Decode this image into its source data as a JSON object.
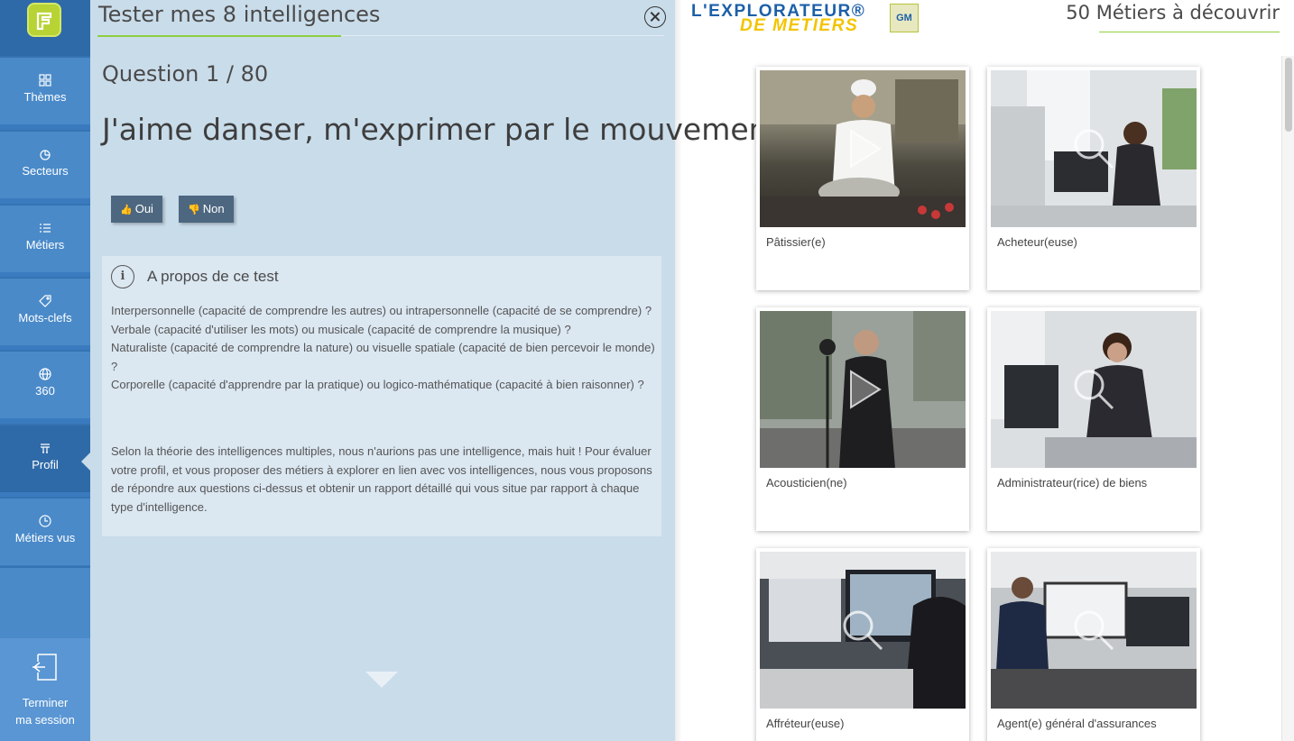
{
  "sidebar": {
    "items": [
      {
        "label": "Thèmes",
        "icon": "grid-icon"
      },
      {
        "label": "Secteurs",
        "icon": "pie-icon"
      },
      {
        "label": "Métiers",
        "icon": "list-icon"
      },
      {
        "label": "Mots-clefs",
        "icon": "tag-icon"
      },
      {
        "label": "360",
        "icon": "globe-icon"
      },
      {
        "label": "Profil",
        "icon": "profile-icon",
        "active": true
      },
      {
        "label": "Métiers vus",
        "icon": "clock-icon"
      }
    ],
    "logout_line1": "Terminer",
    "logout_line2": "ma session"
  },
  "test": {
    "title": "Tester mes 8 intelligences",
    "question_count": "Question 1 / 80",
    "question": "J'aime danser, m'exprimer par le mouvement.",
    "yes_label": "Oui",
    "no_label": "Non",
    "about_title": "A propos de ce test",
    "about_p1": "Interpersonnelle (capacité de comprendre les autres) ou intrapersonnelle (capacité de se comprendre) ?\nVerbale (capacité d'utiliser les mots) ou musicale (capacité de comprendre la musique) ?\nNaturaliste (capacité de comprendre la nature) ou visuelle spatiale (capacité de bien percevoir le monde) ?\nCorporelle (capacité d'apprendre par la pratique) ou logico-mathématique (capacité à bien raisonner) ?",
    "about_p2": "Selon la théorie des intelligences multiples, nous n'aurions pas une intelligence, mais huit ! Pour évaluer votre profil, et vous proposer des métiers à explorer en lien avec vos intelligences, nous vous proposons de répondre aux questions ci-dessus et obtenir un rapport détaillé qui vous situe par rapport à chaque type d'intelligence."
  },
  "brand": {
    "line1": "L'EXPLORATEUR®",
    "line2": "DE METIERS",
    "badge": "GM"
  },
  "jobs": {
    "count_title": "50 Métiers à découvrir",
    "cards": [
      {
        "label": "Pâtissier(e)",
        "overlay": "play-icon",
        "scene": "kitchen"
      },
      {
        "label": "Acheteur(euse)",
        "overlay": "magnifier-icon",
        "scene": "office"
      },
      {
        "label": "Acousticien(ne)",
        "overlay": "play-icon",
        "scene": "street"
      },
      {
        "label": "Administrateur(rice) de biens",
        "overlay": "magnifier-icon",
        "scene": "desk"
      },
      {
        "label": "Affréteur(euse)",
        "overlay": "magnifier-icon",
        "scene": "screens"
      },
      {
        "label": "Agent(e) général d'assurances",
        "overlay": "magnifier-icon",
        "scene": "workstation"
      }
    ]
  },
  "colors": {
    "sidebar": "#4a8ac9",
    "sidebar_active": "#2f6aa8",
    "panel": "#c9dcea",
    "accent_green": "#8fcf3f",
    "button": "#4d6780"
  }
}
